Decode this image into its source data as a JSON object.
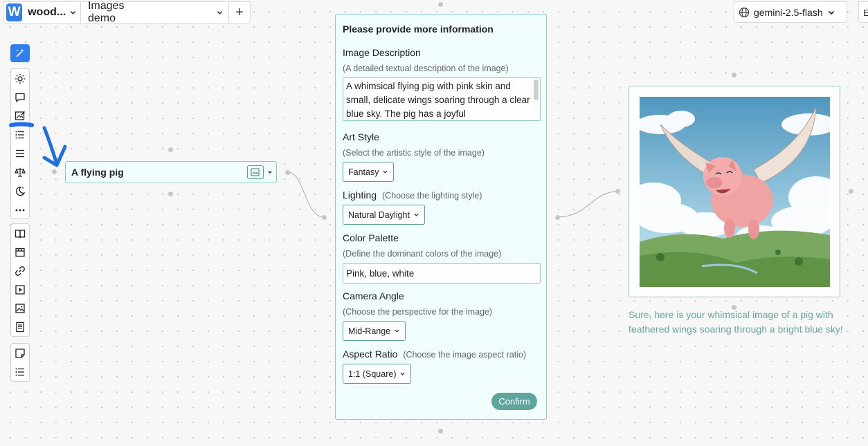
{
  "topbar": {
    "workspace_initial": "W",
    "workspace_name": "wood...",
    "project_name": "Images demo",
    "add_label": "+",
    "model": "gemini-2.5-flash",
    "edge_label": "E"
  },
  "toolbar": {
    "icons": [
      "magic-wand-icon",
      "sun-icon",
      "chat-bubble-icon",
      "image-edit-icon",
      "list-icon",
      "text-lines-icon",
      "scales-icon",
      "moon-sparkle-icon",
      "more-icon",
      "book-icon",
      "film-icon",
      "link-icon",
      "play-icon",
      "image-icon",
      "document-icon",
      "sticky-note-icon",
      "checklist-icon"
    ]
  },
  "input_node": {
    "text": "A flying pig"
  },
  "form": {
    "title": "Please provide more information",
    "image_description": {
      "label": "Image Description",
      "hint": "(A detailed textual description of the image)",
      "value": "A whimsical flying pig with pink skin and small, delicate wings soaring through a clear blue sky. The pig has a joyful"
    },
    "art_style": {
      "label": "Art Style",
      "hint": "(Select the artistic style of the image)",
      "value": "Fantasy"
    },
    "lighting": {
      "label": "Lighting",
      "hint": "(Choose the lighting style)",
      "value": "Natural Daylight"
    },
    "color_palette": {
      "label": "Color Palette",
      "hint": "(Define the dominant colors of the image)",
      "value": "Pink, blue, white"
    },
    "camera_angle": {
      "label": "Camera Angle",
      "hint": "(Choose the perspective for the image)",
      "value": "Mid-Range"
    },
    "aspect_ratio": {
      "label": "Aspect Ratio",
      "hint": "(Choose the image aspect ratio)",
      "value": "1:1 (Square)"
    },
    "confirm_label": "Confirm"
  },
  "output": {
    "caption": "Sure, here is your whimsical image of a pig with feathered wings soaring through a bright blue sky!"
  },
  "colors": {
    "accent": "#2f80ed",
    "node_border": "#8fc9c4",
    "node_bg": "#f0fdfc",
    "confirm_bg": "#5fa59e",
    "caption": "#6aa8a1",
    "annotation": "#1e6fe0"
  }
}
